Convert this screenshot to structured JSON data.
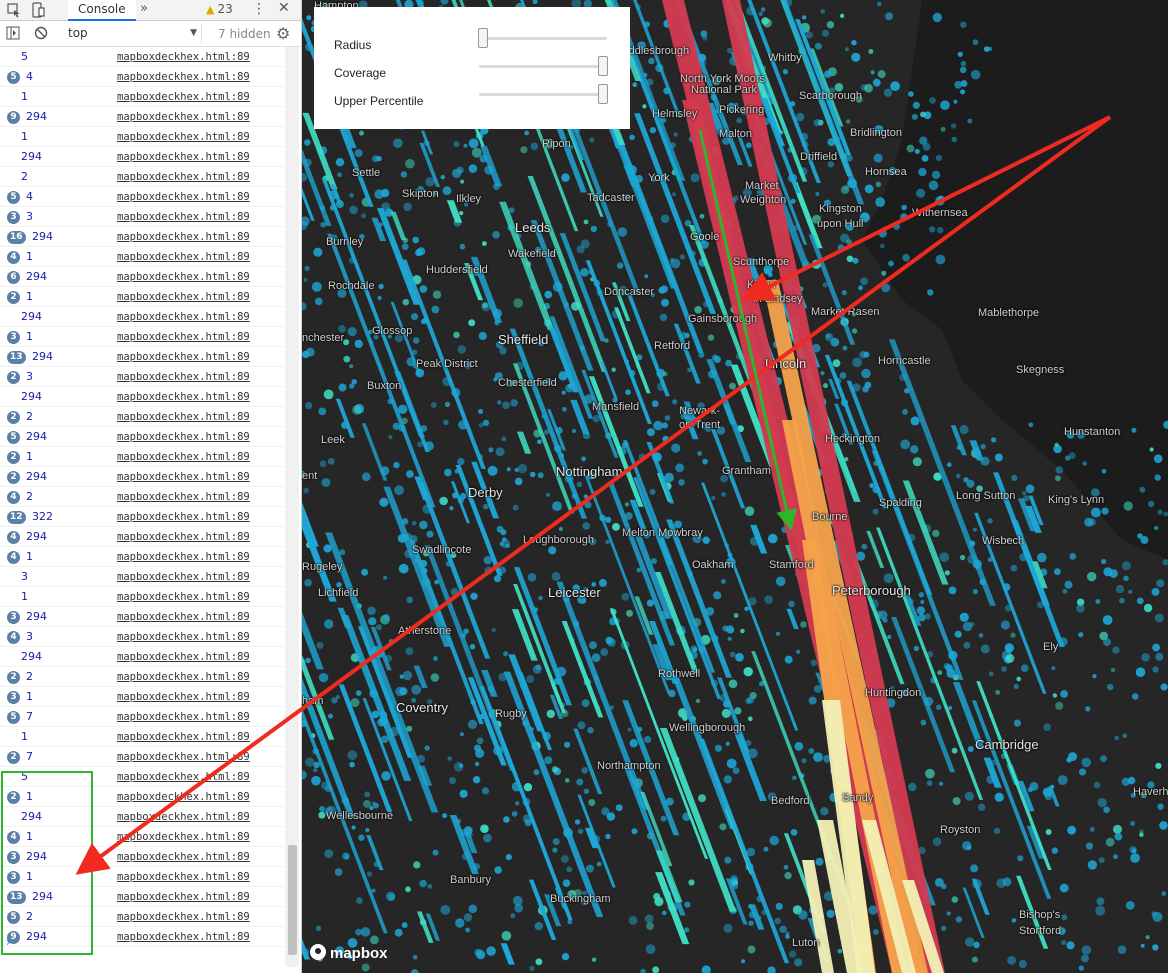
{
  "devtools": {
    "tab_label": "Console",
    "more_tabs": "»",
    "warning_count": "23",
    "context": "top",
    "hidden_label": "7 hidden",
    "log": [
      {
        "badge": "",
        "value": "5",
        "source": "mapboxdeckhex.html:89"
      },
      {
        "badge": "5",
        "value": "4",
        "source": "mapboxdeckhex.html:89"
      },
      {
        "badge": "",
        "value": "1",
        "source": "mapboxdeckhex.html:89"
      },
      {
        "badge": "9",
        "value": "294",
        "source": "mapboxdeckhex.html:89"
      },
      {
        "badge": "",
        "value": "1",
        "source": "mapboxdeckhex.html:89"
      },
      {
        "badge": "",
        "value": "294",
        "source": "mapboxdeckhex.html:89"
      },
      {
        "badge": "",
        "value": "2",
        "source": "mapboxdeckhex.html:89"
      },
      {
        "badge": "5",
        "value": "4",
        "source": "mapboxdeckhex.html:89"
      },
      {
        "badge": "3",
        "value": "3",
        "source": "mapboxdeckhex.html:89"
      },
      {
        "badge": "16",
        "value": "294",
        "source": "mapboxdeckhex.html:89"
      },
      {
        "badge": "4",
        "value": "1",
        "source": "mapboxdeckhex.html:89"
      },
      {
        "badge": "6",
        "value": "294",
        "source": "mapboxdeckhex.html:89"
      },
      {
        "badge": "2",
        "value": "1",
        "source": "mapboxdeckhex.html:89"
      },
      {
        "badge": "",
        "value": "294",
        "source": "mapboxdeckhex.html:89"
      },
      {
        "badge": "3",
        "value": "1",
        "source": "mapboxdeckhex.html:89"
      },
      {
        "badge": "13",
        "value": "294",
        "source": "mapboxdeckhex.html:89"
      },
      {
        "badge": "2",
        "value": "3",
        "source": "mapboxdeckhex.html:89"
      },
      {
        "badge": "",
        "value": "294",
        "source": "mapboxdeckhex.html:89"
      },
      {
        "badge": "2",
        "value": "2",
        "source": "mapboxdeckhex.html:89"
      },
      {
        "badge": "5",
        "value": "294",
        "source": "mapboxdeckhex.html:89"
      },
      {
        "badge": "2",
        "value": "1",
        "source": "mapboxdeckhex.html:89"
      },
      {
        "badge": "2",
        "value": "294",
        "source": "mapboxdeckhex.html:89"
      },
      {
        "badge": "4",
        "value": "2",
        "source": "mapboxdeckhex.html:89"
      },
      {
        "badge": "12",
        "value": "322",
        "source": "mapboxdeckhex.html:89"
      },
      {
        "badge": "4",
        "value": "294",
        "source": "mapboxdeckhex.html:89"
      },
      {
        "badge": "4",
        "value": "1",
        "source": "mapboxdeckhex.html:89"
      },
      {
        "badge": "",
        "value": "3",
        "source": "mapboxdeckhex.html:89"
      },
      {
        "badge": "",
        "value": "1",
        "source": "mapboxdeckhex.html:89"
      },
      {
        "badge": "3",
        "value": "294",
        "source": "mapboxdeckhex.html:89"
      },
      {
        "badge": "4",
        "value": "3",
        "source": "mapboxdeckhex.html:89"
      },
      {
        "badge": "",
        "value": "294",
        "source": "mapboxdeckhex.html:89"
      },
      {
        "badge": "2",
        "value": "2",
        "source": "mapboxdeckhex.html:89"
      },
      {
        "badge": "3",
        "value": "1",
        "source": "mapboxdeckhex.html:89"
      },
      {
        "badge": "5",
        "value": "7",
        "source": "mapboxdeckhex.html:89"
      },
      {
        "badge": "",
        "value": "1",
        "source": "mapboxdeckhex.html:89"
      },
      {
        "badge": "2",
        "value": "7",
        "source": "mapboxdeckhex.html:89"
      },
      {
        "badge": "",
        "value": "5",
        "source": "mapboxdeckhex.html:89"
      },
      {
        "badge": "2",
        "value": "1",
        "source": "mapboxdeckhex.html:89"
      },
      {
        "badge": "",
        "value": "294",
        "source": "mapboxdeckhex.html:89"
      },
      {
        "badge": "4",
        "value": "1",
        "source": "mapboxdeckhex.html:89"
      },
      {
        "badge": "3",
        "value": "294",
        "source": "mapboxdeckhex.html:89"
      },
      {
        "badge": "3",
        "value": "1",
        "source": "mapboxdeckhex.html:89"
      },
      {
        "badge": "13",
        "value": "294",
        "source": "mapboxdeckhex.html:89"
      },
      {
        "badge": "5",
        "value": "2",
        "source": "mapboxdeckhex.html:89"
      },
      {
        "badge": "9",
        "value": "294",
        "source": "mapboxdeckhex.html:89"
      }
    ]
  },
  "controls": {
    "radius_label": "Radius",
    "coverage_label": "Coverage",
    "percentile_label": "Upper Percentile",
    "radius_value": 0.03,
    "coverage_value": 0.97,
    "percentile_value": 0.97
  },
  "map": {
    "attribution_logo": "mapbox",
    "places": [
      {
        "name": "Hampton"
      },
      {
        "name": "Middlesbrough"
      },
      {
        "name": "Whitby"
      },
      {
        "name": "North York Moors"
      },
      {
        "name": "National Park"
      },
      {
        "name": "Scarborough"
      },
      {
        "name": "Helmsley"
      },
      {
        "name": "Pickering"
      },
      {
        "name": "Malton"
      },
      {
        "name": "Bridlington"
      },
      {
        "name": "Ripon"
      },
      {
        "name": "Driffield"
      },
      {
        "name": "Settle"
      },
      {
        "name": "York"
      },
      {
        "name": "Hornsea"
      },
      {
        "name": "Skipton"
      },
      {
        "name": "Ilkley"
      },
      {
        "name": "Tadcaster"
      },
      {
        "name": "Market"
      },
      {
        "name": "Weighton"
      },
      {
        "name": "Kingston"
      },
      {
        "name": "upon Hull"
      },
      {
        "name": "Withernsea"
      },
      {
        "name": "Burnley"
      },
      {
        "name": "Leeds"
      },
      {
        "name": "Goole"
      },
      {
        "name": "Huddersfield"
      },
      {
        "name": "Wakefield"
      },
      {
        "name": "Scunthorpe"
      },
      {
        "name": "Rochdale"
      },
      {
        "name": "Doncaster"
      },
      {
        "name": "Kirton"
      },
      {
        "name": "in Lindsey"
      },
      {
        "name": "Mablethorpe"
      },
      {
        "name": "Gainsborough"
      },
      {
        "name": "Market Rasen"
      },
      {
        "name": "Glossop"
      },
      {
        "name": "Sheffield"
      },
      {
        "name": "Retford"
      },
      {
        "name": "nchester"
      },
      {
        "name": "Peak District"
      },
      {
        "name": "Lincoln"
      },
      {
        "name": "Horncastle"
      },
      {
        "name": "Skegness"
      },
      {
        "name": "Buxton"
      },
      {
        "name": "Chesterfield"
      },
      {
        "name": "Mansfield"
      },
      {
        "name": "Newark-"
      },
      {
        "name": "on-Trent"
      },
      {
        "name": "Heckington"
      },
      {
        "name": "Hunstanton"
      },
      {
        "name": "Leek"
      },
      {
        "name": "Nottingham"
      },
      {
        "name": "Grantham"
      },
      {
        "name": "Derby"
      },
      {
        "name": "Spalding"
      },
      {
        "name": "Long Sutton"
      },
      {
        "name": "King's Lynn"
      },
      {
        "name": "ent"
      },
      {
        "name": "Bourne"
      },
      {
        "name": "Swadlincote"
      },
      {
        "name": "Loughborough"
      },
      {
        "name": "Melton Mowbray"
      },
      {
        "name": "Wisbech"
      },
      {
        "name": "Rugeley"
      },
      {
        "name": "Oakham"
      },
      {
        "name": "Stamford"
      },
      {
        "name": "Lichfield"
      },
      {
        "name": "Leicester"
      },
      {
        "name": "Peterborough"
      },
      {
        "name": "Atherstone"
      },
      {
        "name": "Ely"
      },
      {
        "name": "Rothwell"
      },
      {
        "name": "ham"
      },
      {
        "name": "Huntingdon"
      },
      {
        "name": "Coventry"
      },
      {
        "name": "Rugby"
      },
      {
        "name": "Wellingborough"
      },
      {
        "name": "Cambridge"
      },
      {
        "name": "Northampton"
      },
      {
        "name": "Haverhill"
      },
      {
        "name": "Bedford"
      },
      {
        "name": "Sandy"
      },
      {
        "name": "Wellesbourne"
      },
      {
        "name": "Royston"
      },
      {
        "name": "Banbury"
      },
      {
        "name": "Buckingham"
      },
      {
        "name": "Bishop's"
      },
      {
        "name": "Stortford"
      },
      {
        "name": "Luton"
      }
    ]
  },
  "colors": {
    "bar_cyan": "#1ea7d6",
    "bar_teal": "#3fe0c5",
    "bar_red": "#d33a4f",
    "bar_orange": "#f5a24a",
    "bar_cream": "#f2f0b5",
    "arrow_red": "#ef2a1f",
    "arrow_green": "#2db52d"
  }
}
